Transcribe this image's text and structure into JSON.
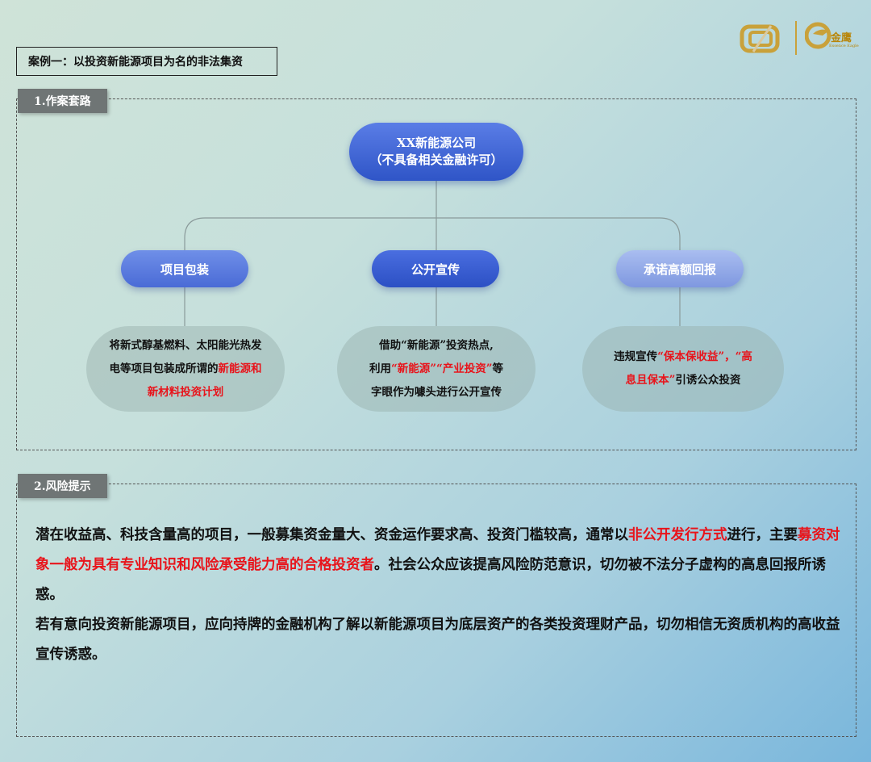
{
  "logo": {
    "brand_name": "金鹰",
    "brand_sub": "Essence Eagle"
  },
  "case_title": "案例一：以投资新能源项目为名的非法集资",
  "section1": {
    "label": "1.作案套路",
    "company_line1": "XX新能源公司",
    "company_line2": "（不具备相关金融许可）",
    "branches": [
      {
        "title": "项目包装",
        "desc_a": "将新式醇基燃料、太阳能光热发",
        "desc_b": "电等项目包装成所谓的",
        "desc_red1": "新能源和",
        "desc_red2": "新材料投资计划"
      },
      {
        "title": "公开宣传",
        "desc_a": "借助“新能源”投资热点,",
        "desc_b": "利用",
        "desc_red1": "“新能源”“产业投资”",
        "desc_c": "等",
        "desc_d": "字眼作为噱头进行公开宣传"
      },
      {
        "title": "承诺高额回报",
        "desc_a": "违规宣传",
        "desc_red1": "“保本保收益”，“高",
        "desc_red2": "息且保本”",
        "desc_b": "引诱公众投资"
      }
    ]
  },
  "section2": {
    "label": "2.风险提示",
    "p1_a": "潜在收益高、科技含量高的项目，一般募集资金量大、资金运作要求高、投资门槛较高，通常以",
    "p1_red1": "非公开发行方式",
    "p1_b": "进行，主要",
    "p1_red2": "募资对象一般为具有专业知识和风险承受能力高的合格投资者",
    "p1_c": "。社会公众应该提高风险防范意识，切勿被不法分子虚构的高息回报所诱惑。",
    "p2": "若有意向投资新能源项目，应向持牌的金融机构了解以新能源项目为底层资产的各类投资理财产品，切勿相信无资质机构的高收益宣传诱惑。"
  },
  "colors": {
    "accent_blue": "#2f55c7",
    "highlight_red": "#e8141b",
    "gold": "#c9a13a"
  }
}
